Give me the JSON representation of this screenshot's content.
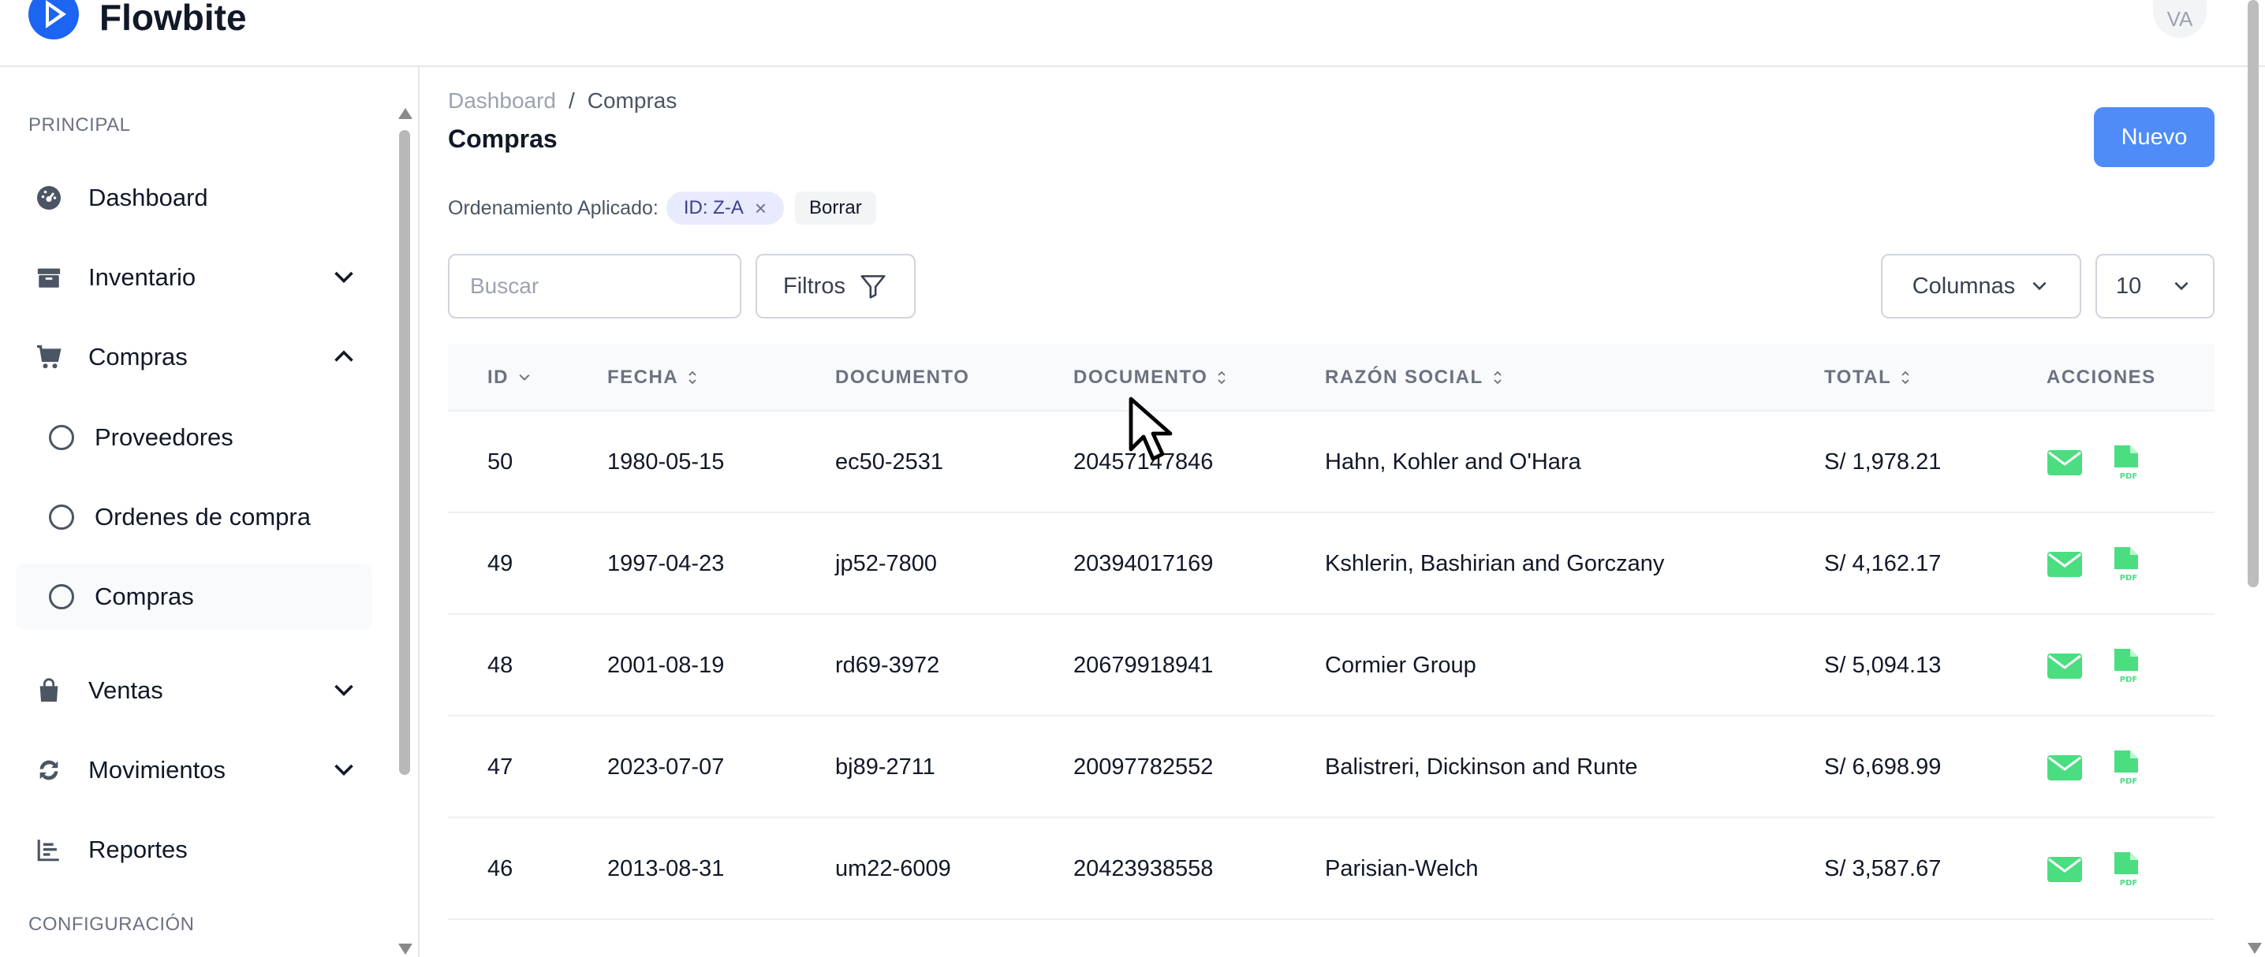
{
  "app": {
    "name": "Flowbite",
    "user_initials": "VA",
    "brand_color": "#1c64f2"
  },
  "sidebar": {
    "section_main": "PRINCIPAL",
    "section_config": "CONFIGURACIÓN",
    "items": [
      {
        "label": "Dashboard",
        "icon": "dashboard-gauge-icon"
      },
      {
        "label": "Inventario",
        "icon": "inventory-icon",
        "expandable": true
      },
      {
        "label": "Compras",
        "icon": "shopping-cart-icon",
        "expanded": true
      },
      {
        "label": "Proveedores",
        "sub": true
      },
      {
        "label": "Ordenes de compra",
        "sub": true
      },
      {
        "label": "Compras",
        "sub": true,
        "active": true
      },
      {
        "label": "Ventas",
        "icon": "shopping-bag-icon",
        "expandable": true
      },
      {
        "label": "Movimientos",
        "icon": "refresh-icon",
        "expandable": true
      },
      {
        "label": "Reportes",
        "icon": "chart-bar-icon"
      }
    ]
  },
  "breadcrumb": {
    "root": "Dashboard",
    "separator": "/",
    "current": "Compras"
  },
  "page": {
    "title": "Compras",
    "new_button": "Nuevo",
    "accent": "#4f8cf7"
  },
  "sorting": {
    "label": "Ordenamiento Aplicado:",
    "chip": "ID: Z-A",
    "chip_remove": "×",
    "clear": "Borrar"
  },
  "toolbar": {
    "search_placeholder": "Buscar",
    "filters_label": "Filtros",
    "columns_label": "Columnas",
    "page_size": "10"
  },
  "table": {
    "headers": [
      "ID",
      "FECHA",
      "DOCUMENTO",
      "DOCUMENTO",
      "RAZÓN SOCIAL",
      "TOTAL",
      "ACCIONES"
    ],
    "rows": [
      {
        "id": "50",
        "fecha": "1980-05-15",
        "documento": "ec50-2531",
        "documento2": "20457147846",
        "razon": "Hahn, Kohler and O'Hara",
        "total": "S/ 1,978.21"
      },
      {
        "id": "49",
        "fecha": "1997-04-23",
        "documento": "jp52-7800",
        "documento2": "20394017169",
        "razon": "Kshlerin, Bashirian and Gorczany",
        "total": "S/ 4,162.17"
      },
      {
        "id": "48",
        "fecha": "2001-08-19",
        "documento": "rd69-3972",
        "documento2": "20679918941",
        "razon": "Cormier Group",
        "total": "S/ 5,094.13"
      },
      {
        "id": "47",
        "fecha": "2023-07-07",
        "documento": "bj89-2711",
        "documento2": "20097782552",
        "razon": "Balistreri, Dickinson and Runte",
        "total": "S/ 6,698.99"
      },
      {
        "id": "46",
        "fecha": "2013-08-31",
        "documento": "um22-6009",
        "documento2": "20423938558",
        "razon": "Parisian-Welch",
        "total": "S/ 3,587.67"
      }
    ],
    "action_icons": [
      "mail-icon",
      "pdf-file-icon"
    ],
    "action_color": "#4ade80"
  }
}
